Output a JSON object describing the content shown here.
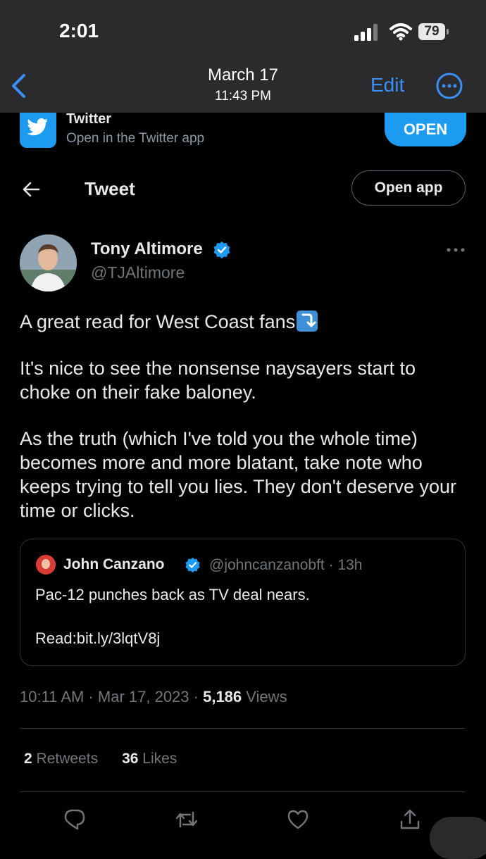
{
  "status_bar": {
    "time": "2:01",
    "battery": "79"
  },
  "photos_header": {
    "date": "March 17",
    "time": "11:43 PM",
    "edit_label": "Edit"
  },
  "app_banner": {
    "title": "Twitter",
    "subtitle": "Open in the Twitter app",
    "open_label": "OPEN"
  },
  "tweet_nav": {
    "title": "Tweet",
    "open_app_label": "Open app"
  },
  "author": {
    "name": "Tony Altimore",
    "handle": "@TJAltimore"
  },
  "tweet": {
    "line1": "A great read for West Coast fans",
    "para2": "It's nice to see the nonsense naysayers start to choke on their fake baloney.",
    "para3": "As the truth (which I've told you the whole time) becomes more and more blatant, take note who keeps trying to tell you lies. They don't deserve your time or clicks."
  },
  "quoted": {
    "name": "John Canzano",
    "handle": "@johncanzanobft",
    "age": "13h",
    "text": "Pac-12 punches back as TV deal nears.",
    "link": "Read:bit.ly/3lqtV8j"
  },
  "meta": {
    "time": "10:11 AM",
    "date": "Mar 17, 2023",
    "views_count": "5,186",
    "views_label": "Views"
  },
  "stats": {
    "retweets_count": "2",
    "retweets_label": "Retweets",
    "likes_count": "36",
    "likes_label": "Likes"
  },
  "icons": [
    "back-chevron-icon",
    "more-icon",
    "twitter-bird-icon",
    "arrow-left-icon",
    "verified-icon",
    "reply-icon",
    "retweet-icon",
    "like-icon",
    "share-icon"
  ],
  "colors": {
    "accent": "#1d9bf0",
    "ios_link": "#3c8ef7",
    "muted": "#71767b"
  }
}
